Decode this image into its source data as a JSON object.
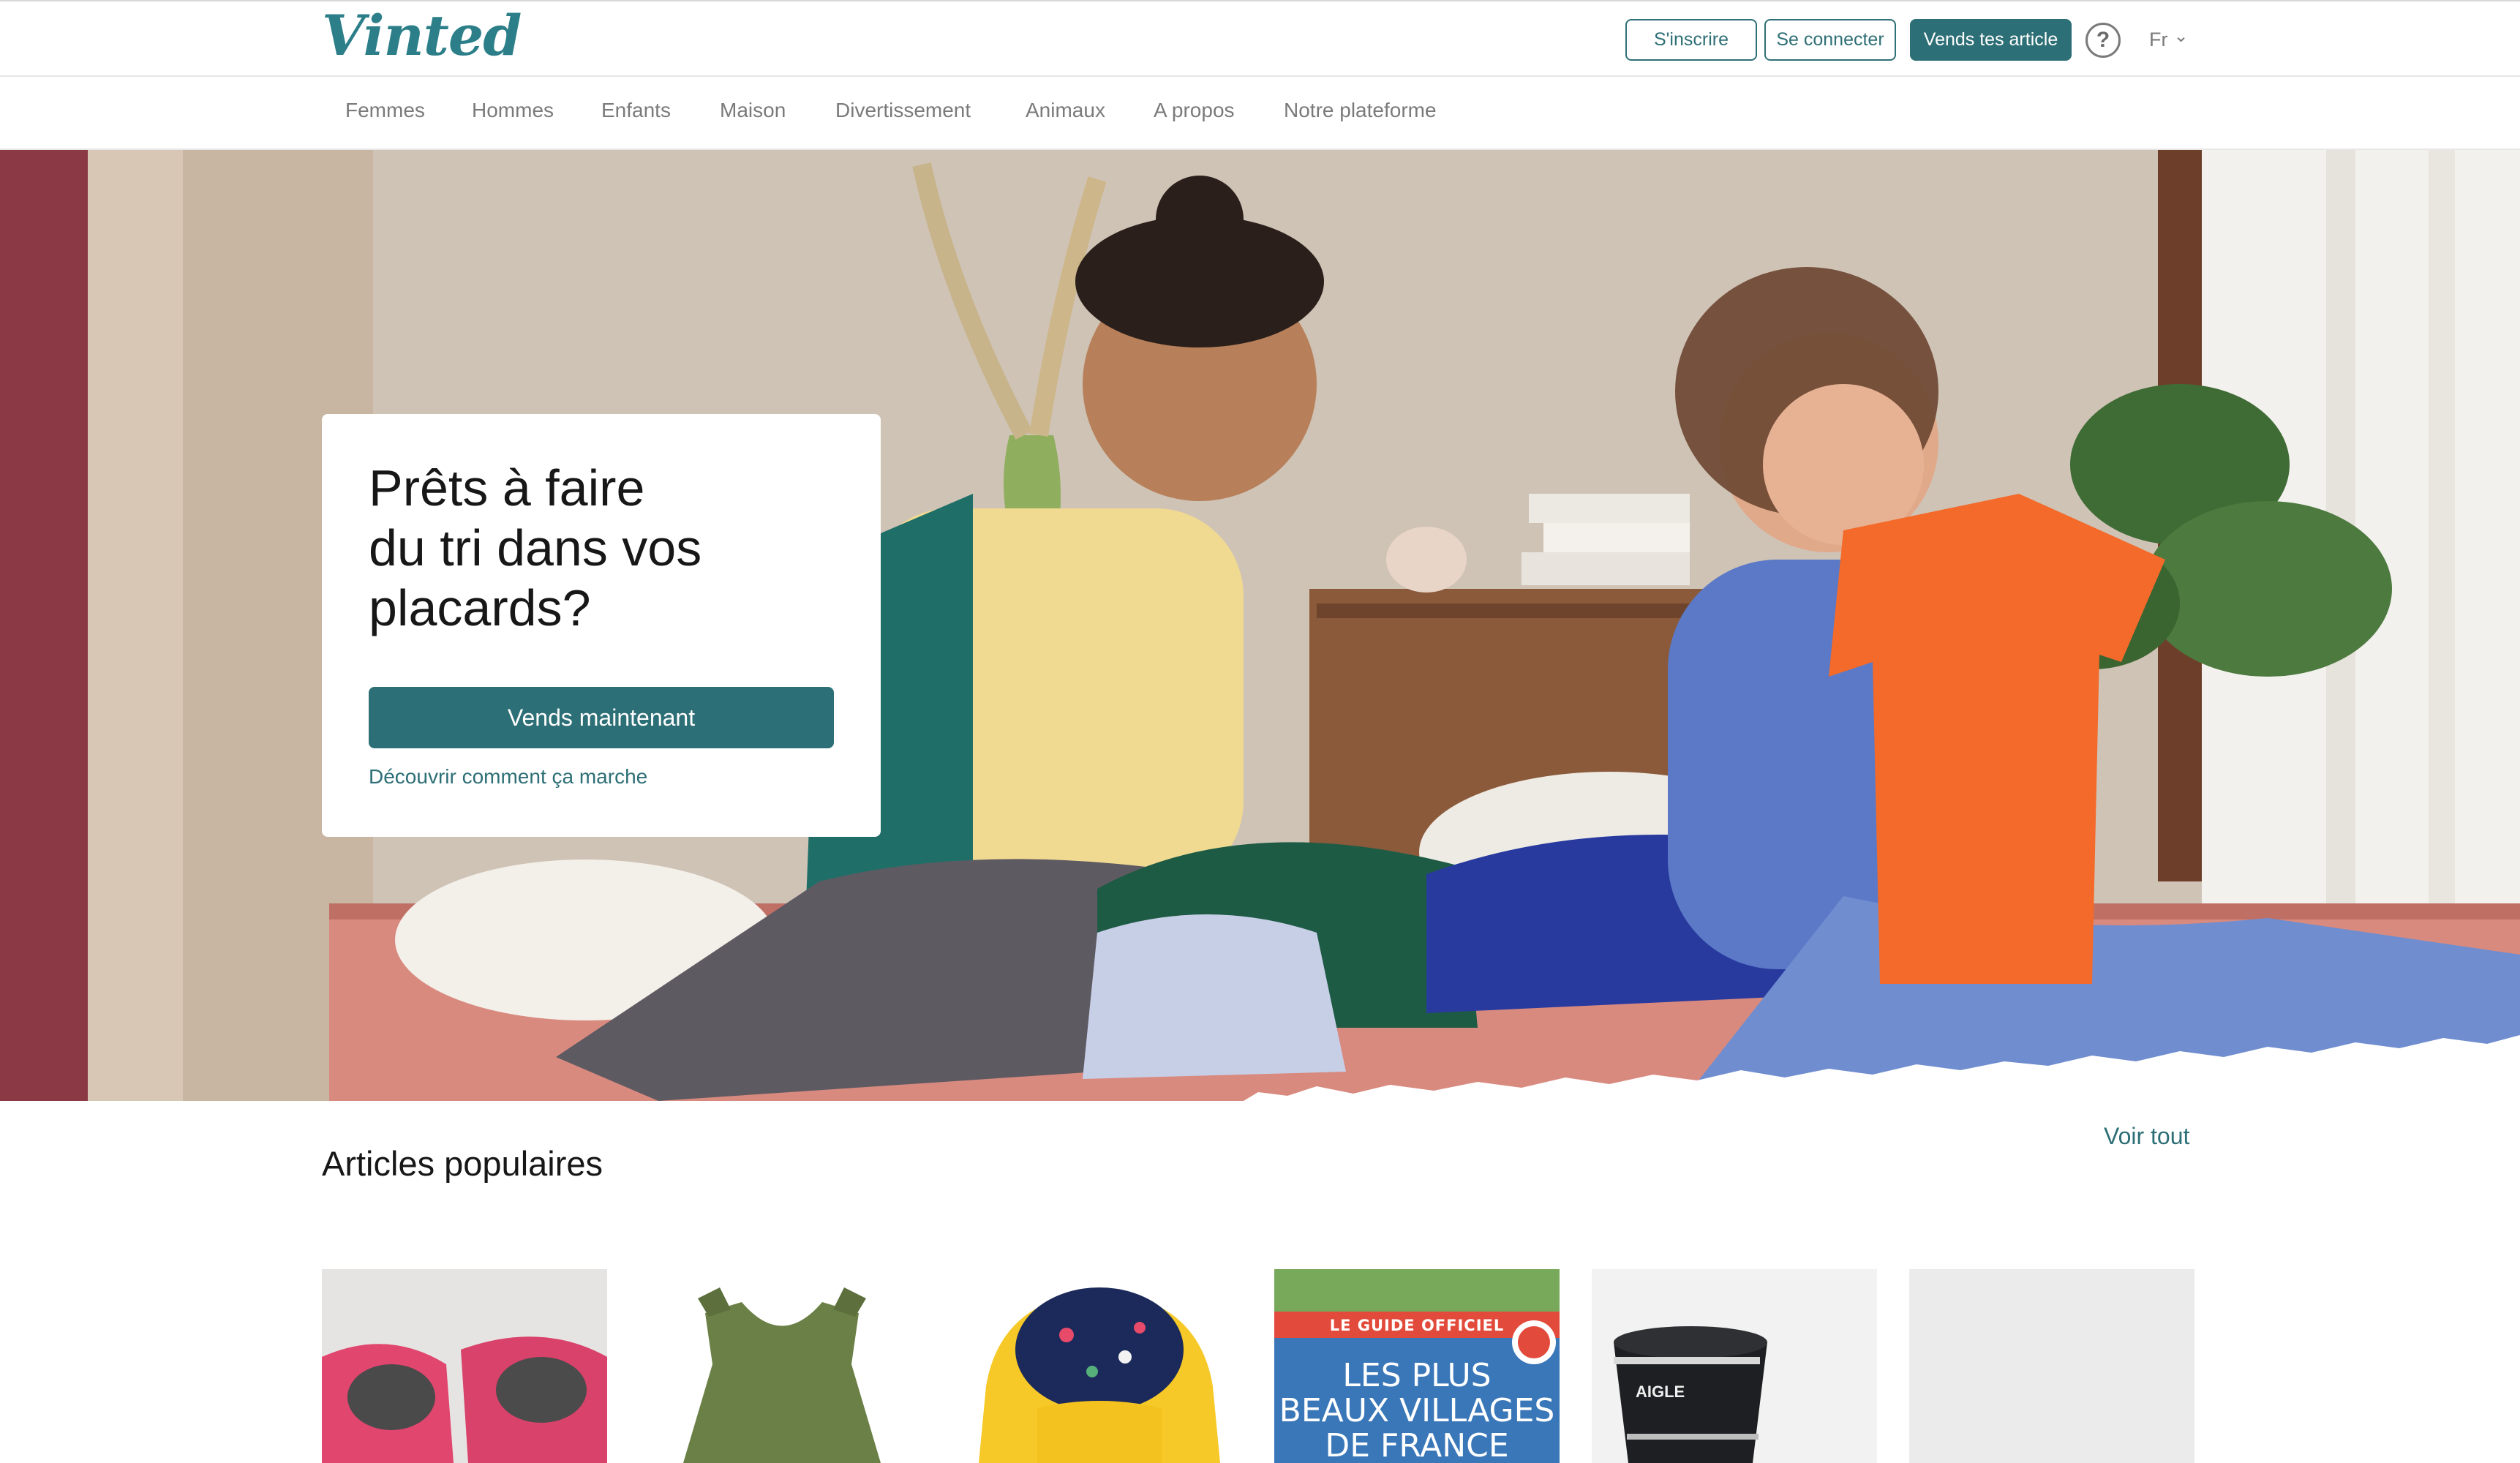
{
  "header": {
    "logo": "Vinted",
    "signup_label": "S'inscrire",
    "login_label": "Se connecter",
    "sell_label": "Vends tes article",
    "help_icon": "?",
    "language": "Fr",
    "language_chevron": "⌄"
  },
  "nav": {
    "items": [
      "Femmes",
      "Hommes",
      "Enfants",
      "Maison",
      "Divertissement",
      "Animaux",
      "A propos",
      "Notre plateforme"
    ]
  },
  "hero": {
    "title_lines": [
      "Prêts à faire",
      "du tri dans vos",
      "placards?"
    ],
    "cta_label": "Vends maintenant",
    "link_label": "Découvrir comment ça marche"
  },
  "popular": {
    "title": "Articles populaires",
    "see_all": "Voir tout",
    "book": {
      "line1": "LE GUIDE OFFICIEL",
      "line2": "LES PLUS",
      "line3": "BEAUX VILLAGES",
      "line4": "DE FRANCE"
    },
    "boot_brand": "AIGLE"
  },
  "colors": {
    "brand": "#2d6f76",
    "text": "#171717",
    "muted": "#7a7a7a"
  }
}
